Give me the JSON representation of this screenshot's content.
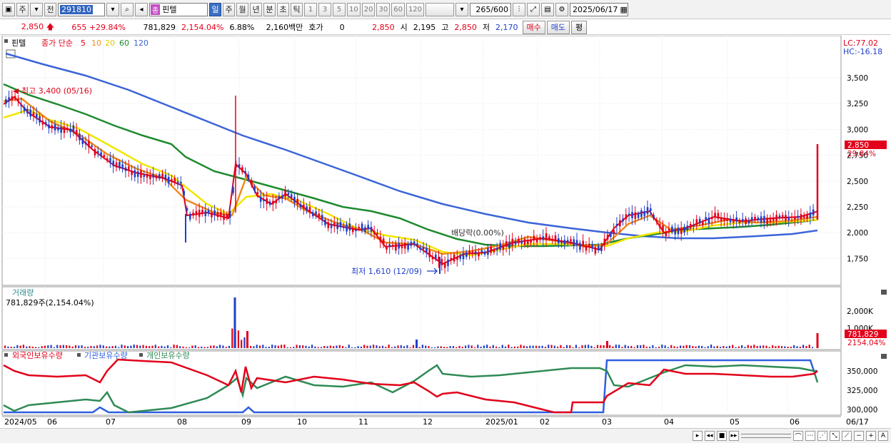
{
  "toolbar": {
    "period_labels": [
      "주",
      "전"
    ],
    "stock_code": "291810",
    "stock_badge": "종",
    "stock_name": "핀텔",
    "intervals": [
      "일",
      "주",
      "월",
      "년",
      "분",
      "초",
      "틱"
    ],
    "numbers": [
      "1",
      "3",
      "5",
      "10",
      "20",
      "30",
      "60",
      "120"
    ],
    "count": "265",
    "count_total": "/600",
    "date": "2025/06/17"
  },
  "quote": {
    "price": "2,850",
    "change": "655",
    "change_pct": "+29.84%",
    "volume": "781,829",
    "volume_pct": "2,154.04%",
    "turnover_pct": "6.88%",
    "amount": "2,160백만",
    "hoga_label": "호가",
    "hoga_value": "0",
    "hoga_price": "2,850",
    "open_label": "시",
    "open": "2,195",
    "high_label": "고",
    "high": "2,850",
    "low_label": "저",
    "low": "2,170",
    "buy_label": "매수",
    "sell_label": "매도",
    "avg_label": "평"
  },
  "price_panel": {
    "name": "핀텔",
    "legend_prefix": "종가 단순",
    "ma_labels": [
      "5",
      "10",
      "20",
      "60",
      "120"
    ],
    "lc": "LC:77.02",
    "hc": "HC:-16.18",
    "y_ticks": [
      "3,500",
      "3,250",
      "3,000",
      "2,750",
      "2,500",
      "2,250",
      "2,000",
      "1,750"
    ],
    "max_annotation": "최고 3,400 (05/16)",
    "min_annotation": "최저 1,610 (12/09)",
    "dividend_annotation": "배당락(0.00%)",
    "last_price_label": "2,850",
    "last_pct_label": "29.84%"
  },
  "volume_panel": {
    "title": "거래량",
    "subtitle": "781,829주(2,154.04%)",
    "y_ticks": [
      "2,000K",
      "1,000K"
    ],
    "last_label": "781,829",
    "last_pct_label": "2154.04%"
  },
  "holding_panel": {
    "legend": [
      "외국인보유수량",
      "기관보유수량",
      "개인보유수량"
    ],
    "y_ticks": [
      "350,000",
      "325,000",
      "300,000"
    ]
  },
  "x_axis": [
    "2024/05",
    "06",
    "07",
    "08",
    "09",
    "10",
    "11",
    "12",
    "2025/01",
    "02",
    "03",
    "04",
    "05",
    "06",
    "06/17"
  ],
  "colors": {
    "up": "#e2001a",
    "down": "#1f3fc9",
    "ma5": "#e2001a",
    "ma10": "#f08a1c",
    "ma20": "#f2e600",
    "ma60": "#1e8a2e",
    "ma120": "#3b64d8",
    "foreign": "#e2001a",
    "institution": "#2f5fe0",
    "individual": "#2f8a55"
  }
}
